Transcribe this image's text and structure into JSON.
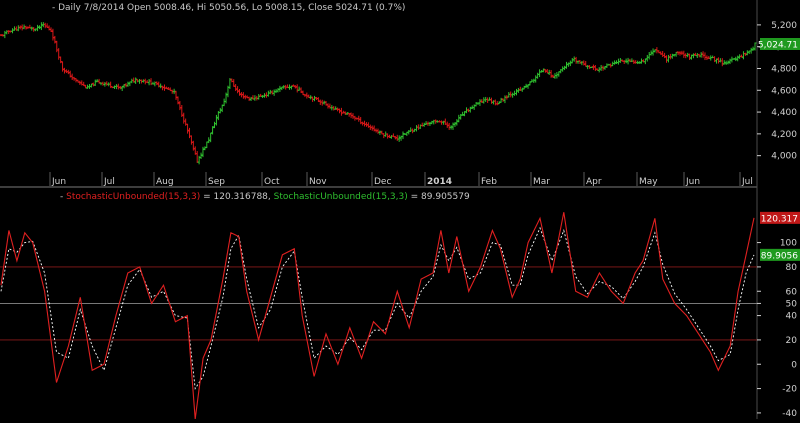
{
  "header": {
    "price_title": "Daily 7/8/2014 Open 5008.46, Hi 5050.56, Lo 5008.15, Close 5024.71 (0.7%)",
    "stoch_k_label": "StochasticUnbounded(15,3,3)",
    "stoch_k_value": " = 120.316788, ",
    "stoch_d_label": "StochasticUnbounded(15,3,3)",
    "stoch_d_value": " = 89.905579"
  },
  "colors": {
    "background": "#000000",
    "up_bar": "#2fbf2f",
    "down_bar": "#d81818",
    "axis_text": "#d0d0d0",
    "title_text": "#c8c8c8",
    "stoch_k": "#e02020",
    "stoch_d": "#ffffff",
    "ref_line_red": "#8a1a1a",
    "ref_line_gray": "#8a8a8a",
    "pane_divider": "#7a7a7a"
  },
  "chart_data": [
    {
      "type": "ohlc",
      "title": "Daily 7/8/2014 Open 5008.46, Hi 5050.56, Lo 5008.15, Close 5024.71 (0.7%)",
      "ylim": [
        3850,
        5300
      ],
      "y_ticks": [
        "4,000",
        "4,200",
        "4,400",
        "4,600",
        "4,800",
        "5,000",
        "5,200"
      ],
      "last_value_label": "5,024.71",
      "x_tick_labels": [
        "Jun",
        "Jul",
        "Aug",
        "Sep",
        "Oct",
        "Nov",
        "Dec",
        "2014",
        "Feb",
        "Mar",
        "Apr",
        "May",
        "Jun",
        "Jul"
      ],
      "grid": false,
      "price_path": [
        [
          0,
          5100
        ],
        [
          5,
          5150
        ],
        [
          12,
          5180
        ],
        [
          18,
          5160
        ],
        [
          22,
          5200
        ],
        [
          26,
          5150
        ],
        [
          32,
          4800
        ],
        [
          38,
          4700
        ],
        [
          45,
          4620
        ],
        [
          50,
          4680
        ],
        [
          56,
          4650
        ],
        [
          62,
          4620
        ],
        [
          70,
          4700
        ],
        [
          76,
          4680
        ],
        [
          82,
          4650
        ],
        [
          90,
          4580
        ],
        [
          96,
          4280
        ],
        [
          102,
          3950
        ],
        [
          108,
          4150
        ],
        [
          112,
          4350
        ],
        [
          116,
          4500
        ],
        [
          119,
          4700
        ],
        [
          124,
          4560
        ],
        [
          130,
          4520
        ],
        [
          138,
          4560
        ],
        [
          146,
          4620
        ],
        [
          152,
          4640
        ],
        [
          158,
          4560
        ],
        [
          166,
          4500
        ],
        [
          174,
          4420
        ],
        [
          182,
          4370
        ],
        [
          190,
          4280
        ],
        [
          198,
          4200
        ],
        [
          206,
          4160
        ],
        [
          214,
          4240
        ],
        [
          222,
          4300
        ],
        [
          228,
          4320
        ],
        [
          234,
          4260
        ],
        [
          240,
          4380
        ],
        [
          246,
          4460
        ],
        [
          252,
          4520
        ],
        [
          258,
          4480
        ],
        [
          264,
          4560
        ],
        [
          270,
          4600
        ],
        [
          276,
          4680
        ],
        [
          282,
          4800
        ],
        [
          287,
          4720
        ],
        [
          292,
          4800
        ],
        [
          298,
          4880
        ],
        [
          304,
          4830
        ],
        [
          310,
          4790
        ],
        [
          316,
          4830
        ],
        [
          322,
          4870
        ],
        [
          328,
          4860
        ],
        [
          334,
          4870
        ],
        [
          340,
          4980
        ],
        [
          346,
          4890
        ],
        [
          352,
          4950
        ],
        [
          358,
          4910
        ],
        [
          364,
          4920
        ],
        [
          370,
          4890
        ],
        [
          376,
          4850
        ],
        [
          382,
          4890
        ],
        [
          388,
          4950
        ],
        [
          391,
          4990
        ],
        [
          392,
          5024.71
        ]
      ]
    },
    {
      "type": "line",
      "title": "",
      "ylim": [
        -45,
        135
      ],
      "y_ticks": [
        -40,
        -20,
        0,
        20,
        40,
        50,
        60,
        80,
        100
      ],
      "reference_lines": [
        80,
        50,
        20
      ],
      "last_value_labels": [
        "120.317",
        "89.9056"
      ],
      "series": [
        {
          "name": "StochasticUnbounded(15,3,3)",
          "color": "#e02020",
          "last_value": 120.316788,
          "points": [
            [
              0,
              65
            ],
            [
              4,
              110
            ],
            [
              8,
              85
            ],
            [
              12,
              108
            ],
            [
              16,
              100
            ],
            [
              22,
              60
            ],
            [
              28,
              -15
            ],
            [
              34,
              15
            ],
            [
              40,
              55
            ],
            [
              46,
              -5
            ],
            [
              52,
              0
            ],
            [
              58,
              40
            ],
            [
              64,
              75
            ],
            [
              70,
              80
            ],
            [
              76,
              50
            ],
            [
              82,
              65
            ],
            [
              88,
              35
            ],
            [
              94,
              40
            ],
            [
              98,
              -45
            ],
            [
              102,
              5
            ],
            [
              106,
              20
            ],
            [
              112,
              70
            ],
            [
              116,
              108
            ],
            [
              120,
              105
            ],
            [
              124,
              60
            ],
            [
              130,
              20
            ],
            [
              136,
              55
            ],
            [
              142,
              90
            ],
            [
              148,
              95
            ],
            [
              152,
              40
            ],
            [
              158,
              -10
            ],
            [
              164,
              25
            ],
            [
              170,
              0
            ],
            [
              176,
              30
            ],
            [
              182,
              5
            ],
            [
              188,
              35
            ],
            [
              194,
              25
            ],
            [
              200,
              60
            ],
            [
              206,
              30
            ],
            [
              212,
              70
            ],
            [
              218,
              75
            ],
            [
              222,
              110
            ],
            [
              226,
              75
            ],
            [
              230,
              105
            ],
            [
              236,
              60
            ],
            [
              242,
              80
            ],
            [
              248,
              110
            ],
            [
              252,
              95
            ],
            [
              258,
              55
            ],
            [
              262,
              70
            ],
            [
              266,
              100
            ],
            [
              272,
              120
            ],
            [
              278,
              75
            ],
            [
              284,
              125
            ],
            [
              290,
              60
            ],
            [
              296,
              55
            ],
            [
              302,
              75
            ],
            [
              308,
              60
            ],
            [
              314,
              50
            ],
            [
              320,
              75
            ],
            [
              324,
              85
            ],
            [
              330,
              120
            ],
            [
              334,
              70
            ],
            [
              340,
              50
            ],
            [
              346,
              40
            ],
            [
              350,
              30
            ],
            [
              354,
              20
            ],
            [
              358,
              10
            ],
            [
              362,
              -5
            ],
            [
              368,
              15
            ],
            [
              372,
              60
            ],
            [
              376,
              90
            ],
            [
              380,
              120.316788
            ]
          ]
        },
        {
          "name": "StochasticUnbounded(15,3,3)",
          "color": "#ffffff",
          "last_value": 89.905579,
          "points": [
            [
              0,
              60
            ],
            [
              4,
              95
            ],
            [
              8,
              92
            ],
            [
              12,
              100
            ],
            [
              16,
              101
            ],
            [
              22,
              75
            ],
            [
              28,
              10
            ],
            [
              34,
              5
            ],
            [
              40,
              45
            ],
            [
              46,
              15
            ],
            [
              52,
              -5
            ],
            [
              58,
              30
            ],
            [
              64,
              65
            ],
            [
              70,
              78
            ],
            [
              76,
              55
            ],
            [
              82,
              60
            ],
            [
              88,
              40
            ],
            [
              94,
              38
            ],
            [
              98,
              -20
            ],
            [
              102,
              -10
            ],
            [
              106,
              15
            ],
            [
              112,
              55
            ],
            [
              116,
              95
            ],
            [
              120,
              106
            ],
            [
              124,
              70
            ],
            [
              130,
              30
            ],
            [
              136,
              45
            ],
            [
              142,
              80
            ],
            [
              148,
              93
            ],
            [
              152,
              55
            ],
            [
              158,
              5
            ],
            [
              164,
              15
            ],
            [
              170,
              8
            ],
            [
              176,
              22
            ],
            [
              182,
              12
            ],
            [
              188,
              28
            ],
            [
              194,
              28
            ],
            [
              200,
              50
            ],
            [
              206,
              38
            ],
            [
              212,
              60
            ],
            [
              218,
              72
            ],
            [
              222,
              98
            ],
            [
              226,
              85
            ],
            [
              230,
              96
            ],
            [
              236,
              70
            ],
            [
              242,
              75
            ],
            [
              248,
              100
            ],
            [
              252,
              98
            ],
            [
              258,
              65
            ],
            [
              262,
              65
            ],
            [
              266,
              90
            ],
            [
              272,
              112
            ],
            [
              278,
              85
            ],
            [
              284,
              110
            ],
            [
              290,
              72
            ],
            [
              296,
              58
            ],
            [
              302,
              68
            ],
            [
              308,
              64
            ],
            [
              314,
              54
            ],
            [
              320,
              68
            ],
            [
              324,
              80
            ],
            [
              330,
              108
            ],
            [
              334,
              82
            ],
            [
              340,
              58
            ],
            [
              346,
              45
            ],
            [
              350,
              35
            ],
            [
              354,
              25
            ],
            [
              358,
              15
            ],
            [
              362,
              3
            ],
            [
              368,
              8
            ],
            [
              372,
              45
            ],
            [
              376,
              75
            ],
            [
              380,
              89.905579
            ]
          ]
        }
      ]
    }
  ]
}
